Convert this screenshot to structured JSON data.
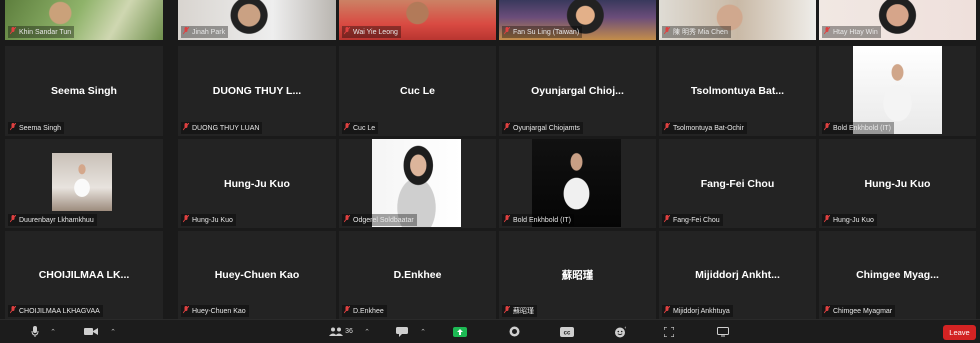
{
  "participants": [
    {
      "label": "Khin Sandar Tun",
      "name": "",
      "video": "cam"
    },
    {
      "label": "Jinah Park",
      "name": "",
      "video": "cam"
    },
    {
      "label": "Wai Yie Leong",
      "name": "",
      "video": "cam"
    },
    {
      "label": "Fan Su Ling (Taiwan)",
      "name": "",
      "video": "cam"
    },
    {
      "label": "陳 明秀 Mia Chen",
      "name": "",
      "video": "cam"
    },
    {
      "label": "Htay Htay Win",
      "name": "",
      "video": "cam"
    },
    {
      "label": "Seema Singh",
      "name": "Seema Singh",
      "video": "none"
    },
    {
      "label": "DUONG THUY LUAN",
      "name": "DUONG THUY L...",
      "video": "none"
    },
    {
      "label": "Cuc Le",
      "name": "Cuc Le",
      "video": "none"
    },
    {
      "label": "Oyunjargal Chiojamts",
      "name": "Oyunjargal  Chioj...",
      "video": "none"
    },
    {
      "label": "Tsolmontuya Bat-Ochir",
      "name": "Tsolmontuya  Bat...",
      "video": "none"
    },
    {
      "label": "Bold Enkhbold (IT)",
      "name": "",
      "video": "photo"
    },
    {
      "label": "Duurenbayr Lkhamkhuu",
      "name": "",
      "video": "photo"
    },
    {
      "label": "Hung-Ju Kuo",
      "name": "Hung-Ju Kuo",
      "video": "none"
    },
    {
      "label": "Odgerel Soldbaatar",
      "name": "",
      "video": "photo"
    },
    {
      "label": "Bold Enkhbold (IT)",
      "name": "",
      "video": "photo"
    },
    {
      "label": "Fang-Fei Chou",
      "name": "Fang-Fei Chou",
      "video": "none"
    },
    {
      "label": "Hung-Ju Kuo",
      "name": "Hung-Ju Kuo",
      "video": "none"
    },
    {
      "label": "CHOIJILMAA LKHAGVAA",
      "name": "CHOIJILMAA  LK...",
      "video": "none"
    },
    {
      "label": "Huey-Chuen Kao",
      "name": "Huey-Chuen Kao",
      "video": "none"
    },
    {
      "label": "D.Enkhee",
      "name": "D.Enkhee",
      "video": "none"
    },
    {
      "label": "蘇昭瑾",
      "name": "蘇昭瑾",
      "video": "none"
    },
    {
      "label": "Mijiddorj Ankhtuya",
      "name": "Mijiddorj  Ankht...",
      "video": "none"
    },
    {
      "label": "Chimgee Myagmar",
      "name": "Chimgee  Myag...",
      "video": "none"
    }
  ],
  "toolbar": {
    "participants_count": "36",
    "leave_label": "Leave",
    "icons": [
      "microphone-icon",
      "video-camera-icon",
      "participants-icon",
      "chat-icon",
      "share-screen-icon",
      "record-icon",
      "cc-icon",
      "reactions-icon",
      "fullscreen-icon",
      "view-icon"
    ]
  },
  "colors": {
    "tile_bg": "#232323",
    "page_bg": "#1a1a1a",
    "leave_red": "#d32323",
    "share_green": "#1db954",
    "muted_mic_red": "#e04040"
  }
}
